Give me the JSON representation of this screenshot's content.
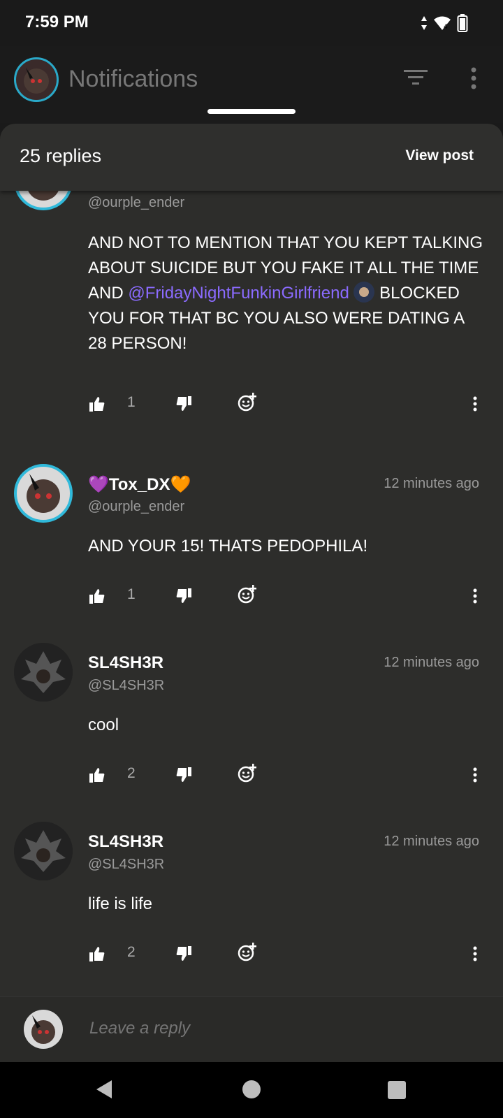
{
  "status_bar": {
    "time": "7:59 PM"
  },
  "header": {
    "title": "Notifications"
  },
  "sheet": {
    "replies_count": "25 replies",
    "view_post": "View post"
  },
  "comments": [
    {
      "name": "",
      "handle": "@ourple_ender",
      "time": "",
      "body_before": "AND NOT TO MENTION THAT YOU KEPT TALKING ABOUT SUICIDE BUT YOU FAKE IT ALL THE TIME AND ",
      "mention": "@FridayNightFunkinGirlfriend",
      "body_after": " BLOCKED YOU FOR THAT BC YOU ALSO WERE DATING A 28 PERSON!",
      "likes": "1"
    },
    {
      "name": "💜Tox_DX🧡",
      "handle": "@ourple_ender",
      "time": "12 minutes ago",
      "body": "AND YOUR 15! THATS PEDOPHILA!",
      "likes": "1"
    },
    {
      "name": "SL4SH3R",
      "handle": "@SL4SH3R",
      "time": "12 minutes ago",
      "body": "cool",
      "likes": "2"
    },
    {
      "name": "SL4SH3R",
      "handle": "@SL4SH3R",
      "time": "12 minutes ago",
      "body": "life is life",
      "likes": "2"
    }
  ],
  "reply_bar": {
    "placeholder": "Leave a reply"
  },
  "icons": {
    "like": "thumbs-up-icon",
    "dislike": "thumbs-down-icon",
    "react": "add-emoji-icon",
    "more": "more-vertical-icon",
    "filter": "filter-icon"
  },
  "colors": {
    "mention": "#8b6bff",
    "avatar_ring": "#30b9da"
  }
}
